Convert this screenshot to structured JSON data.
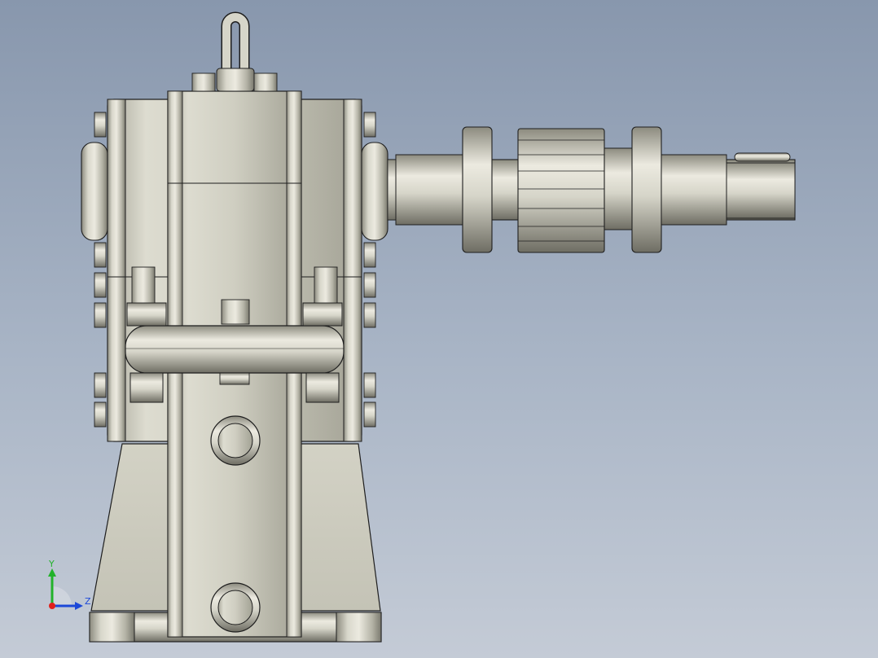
{
  "colors": {
    "background_top": "#8897ad",
    "background_bottom": "#c4cbd6",
    "metal_light": "#eceae0",
    "metal_mid": "#c9c8bb",
    "metal_dark": "#8c8b7f",
    "edge": "#1e1e1e",
    "axis_x": "#e0201c",
    "axis_y": "#22b22a",
    "axis_z": "#1c48d8"
  },
  "triad": {
    "y_label": "Y",
    "z_label": "Z"
  },
  "model": {
    "parts": [
      "lifting-eye-bolt",
      "gearbox-housing",
      "side-bearing-cover",
      "output-shaft",
      "gear-pinion",
      "drain-plug",
      "inspection-plug",
      "base-foot"
    ]
  }
}
